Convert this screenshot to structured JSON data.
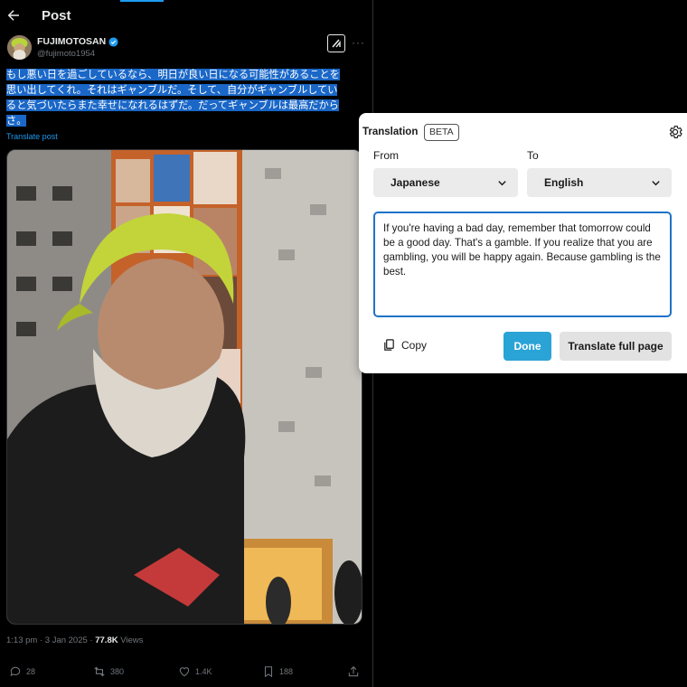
{
  "header": {
    "title": "Post"
  },
  "author": {
    "name": "FUJIMOTOSAN",
    "handle": "@fujimoto1954"
  },
  "tweet": {
    "lines": [
      "もし悪い日を過ごしているなら、明日が良い日になる可能性があることを",
      "思い出してくれ。それはギャンブルだ。そして、自分がギャンブルしてい",
      "ると気づいたらまた幸せになれるはずだ。だってギャンブルは最高だから",
      "さ。"
    ],
    "translate_link": "Translate post",
    "time": "1:13 pm · 3 Jan 2025 · ",
    "views_count": "77.8K",
    "views_label": " Views"
  },
  "actions": {
    "replies": "28",
    "reposts": "380",
    "likes": "1.4K",
    "bookmarks": "188"
  },
  "translation": {
    "title": "Translation",
    "badge": "BETA",
    "from_label": "From",
    "to_label": "To",
    "from_value": "Japanese",
    "to_value": "English",
    "result": "If you're having a bad day, remember that tomorrow could be a good day. That's a gamble. If you realize that you are gambling, you will be happy again. Because gambling is the best.",
    "copy_label": "Copy",
    "done_label": "Done",
    "full_page_label": "Translate full page"
  },
  "colors": {
    "accent": "#1d9bf0",
    "selection": "#1a67c7",
    "done_button": "#2aa3d6"
  }
}
